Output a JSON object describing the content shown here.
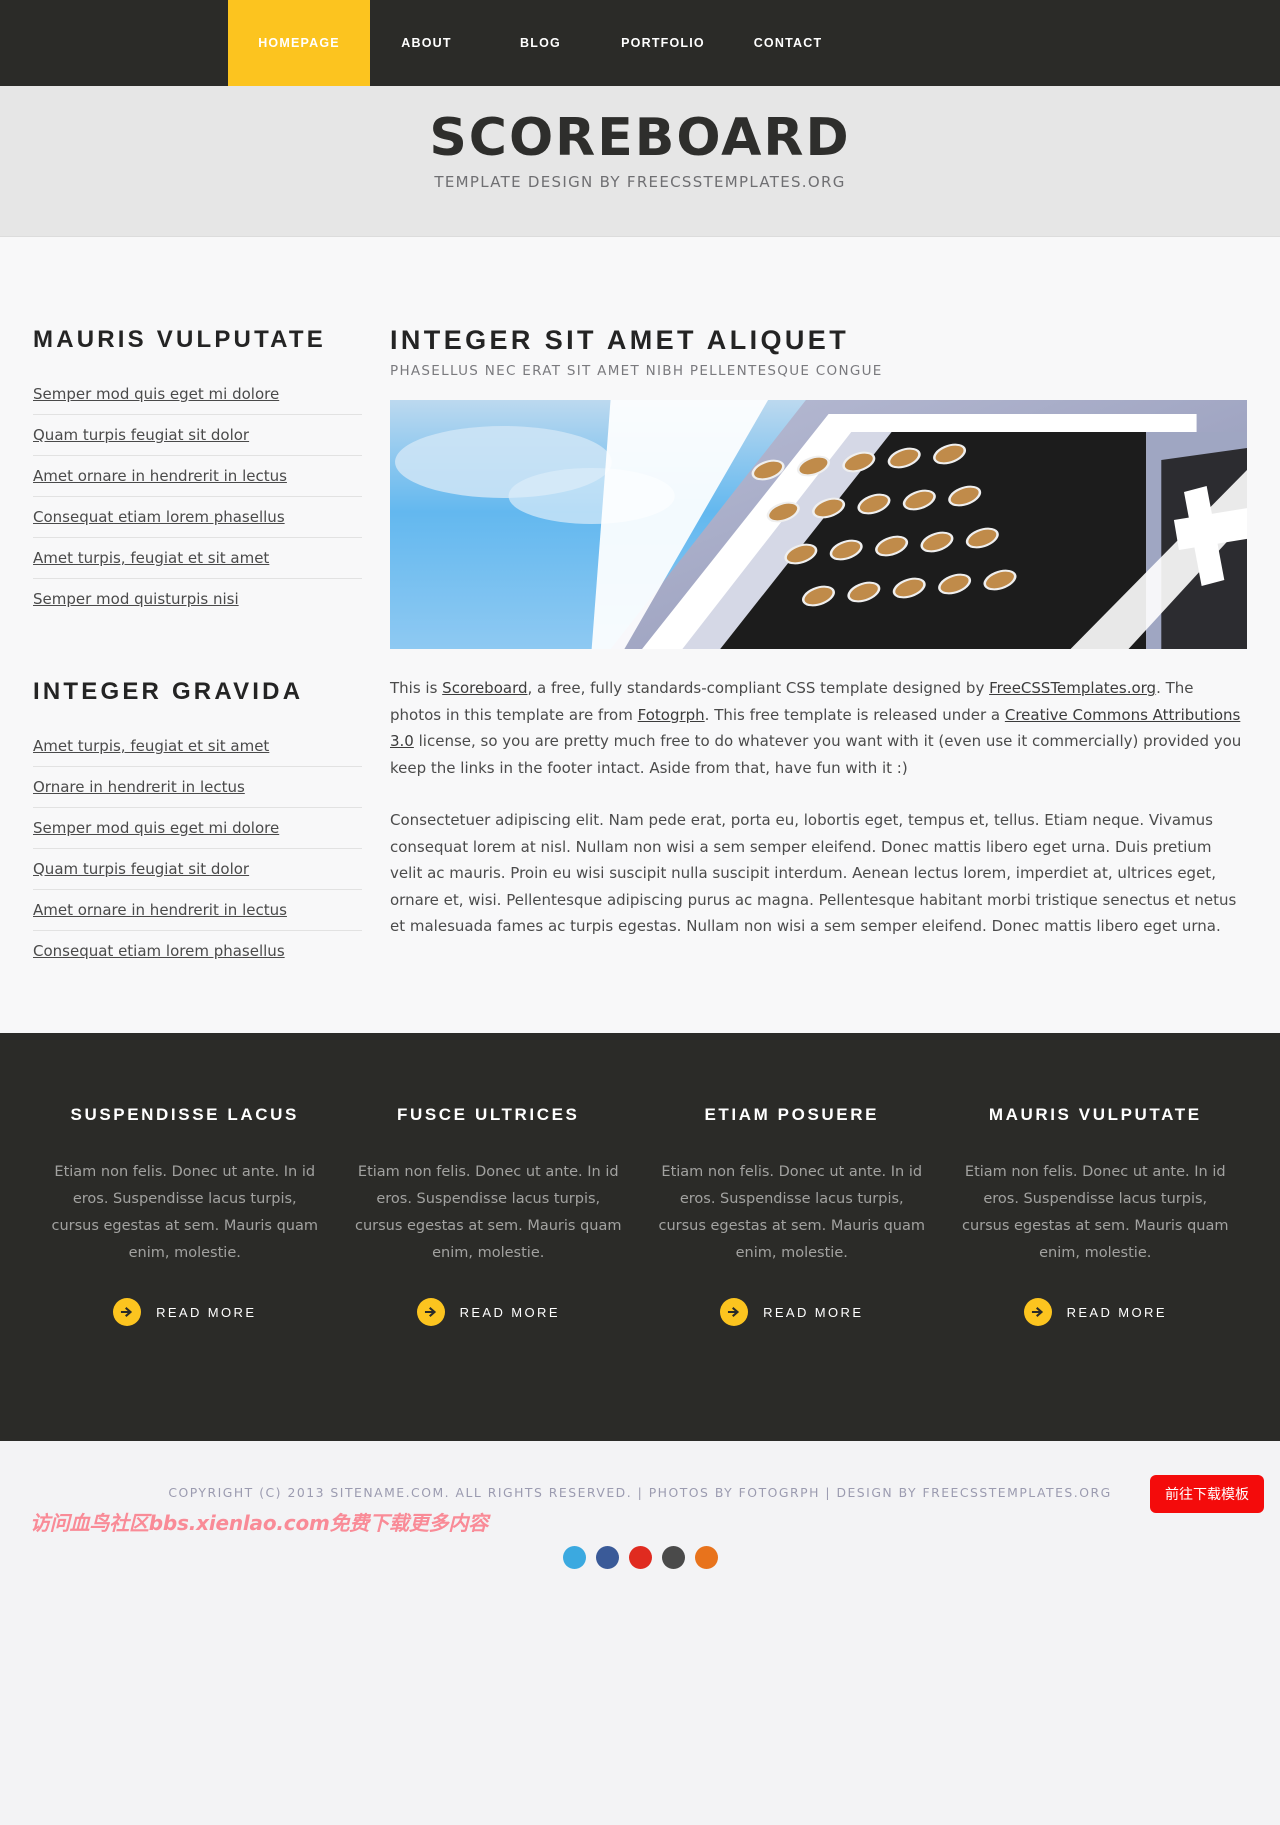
{
  "nav": {
    "items": [
      {
        "label": "HOMEPAGE",
        "active": true
      },
      {
        "label": "ABOUT",
        "active": false
      },
      {
        "label": "BLOG",
        "active": false
      },
      {
        "label": "PORTFOLIO",
        "active": false
      },
      {
        "label": "CONTACT",
        "active": false
      }
    ]
  },
  "masthead": {
    "title": "SCOREBOARD",
    "tagline": "TEMPLATE DESIGN BY FREECSSTEMPLATES.ORG"
  },
  "sidebar": {
    "section1": {
      "heading": "MAURIS VULPUTATE",
      "links": [
        "Semper mod quis eget mi dolore",
        "Quam turpis feugiat sit dolor",
        "Amet ornare in hendrerit in lectus",
        "Consequat etiam lorem phasellus",
        "Amet turpis, feugiat et sit amet",
        "Semper mod quisturpis nisi"
      ]
    },
    "section2": {
      "heading": "INTEGER GRAVIDA",
      "links": [
        "Amet turpis, feugiat et sit amet",
        "Ornare in hendrerit in lectus",
        "Semper mod quis eget mi dolore",
        "Quam turpis feugiat sit dolor",
        "Amet ornare in hendrerit in lectus",
        "Consequat etiam lorem phasellus"
      ]
    }
  },
  "main": {
    "heading": "INTEGER SIT AMET ALIQUET",
    "subheading": "PHASELLUS NEC ERAT SIT AMET NIBH PELLENTESQUE CONGUE",
    "hero_alt": "scoreboard-photo",
    "paragraph1": {
      "p1": "This is ",
      "link1": "Scoreboard",
      "p2": ", a free, fully standards-compliant CSS template designed by ",
      "link2": "FreeCSSTemplates.org",
      "p3": ". The photos in this template are from ",
      "link3": "Fotogrph",
      "p4": ". This free template is released under a ",
      "link4": "Creative Commons Attributions 3.0",
      "p5": " license, so you are pretty much free to do whatever you want with it (even use it commercially) provided you keep the links in the footer intact. Aside from that, have fun with it :)"
    },
    "paragraph2": "Consectetuer adipiscing elit. Nam pede erat, porta eu, lobortis eget, tempus et, tellus. Etiam neque. Vivamus consequat lorem at nisl. Nullam non wisi a sem semper eleifend. Donec mattis libero eget urna. Duis pretium velit ac mauris. Proin eu wisi suscipit nulla suscipit interdum. Aenean lectus lorem, imperdiet at, ultrices eget, ornare et, wisi. Pellentesque adipiscing purus ac magna. Pellentesque habitant morbi tristique senectus et netus et malesuada fames ac turpis egestas. Nullam non wisi a sem semper eleifend. Donec mattis libero eget urna."
  },
  "footer": {
    "columns": [
      {
        "heading": "SUSPENDISSE LACUS",
        "body": "Etiam non felis. Donec ut ante. In id eros. Suspendisse lacus turpis, cursus egestas at sem. Mauris quam enim, molestie.",
        "cta": "READ MORE"
      },
      {
        "heading": "FUSCE ULTRICES",
        "body": "Etiam non felis. Donec ut ante. In id eros. Suspendisse lacus turpis, cursus egestas at sem. Mauris quam enim, molestie.",
        "cta": "READ MORE"
      },
      {
        "heading": "ETIAM POSUERE",
        "body": "Etiam non felis. Donec ut ante. In id eros. Suspendisse lacus turpis, cursus egestas at sem. Mauris quam enim, molestie.",
        "cta": "READ MORE"
      },
      {
        "heading": "MAURIS VULPUTATE",
        "body": "Etiam non felis. Donec ut ante. In id eros. Suspendisse lacus turpis, cursus egestas at sem. Mauris quam enim, molestie.",
        "cta": "READ MORE"
      }
    ]
  },
  "copyright": {
    "text": "COPYRIGHT (C) 2013 SITENAME.COM. ALL RIGHTS RESERVED. | PHOTOS BY FOTOGRPH | DESIGN BY FREECSSTEMPLATES.ORG",
    "download_button": "前往下载模板",
    "watermark": "访问血鸟社区bbs.xienlao.com免费下载更多内容"
  },
  "colors": {
    "accent_yellow": "#fcc41f",
    "dark": "#2b2b28",
    "download_red": "#f40b0b",
    "watermark_pink": "#f98b97"
  }
}
